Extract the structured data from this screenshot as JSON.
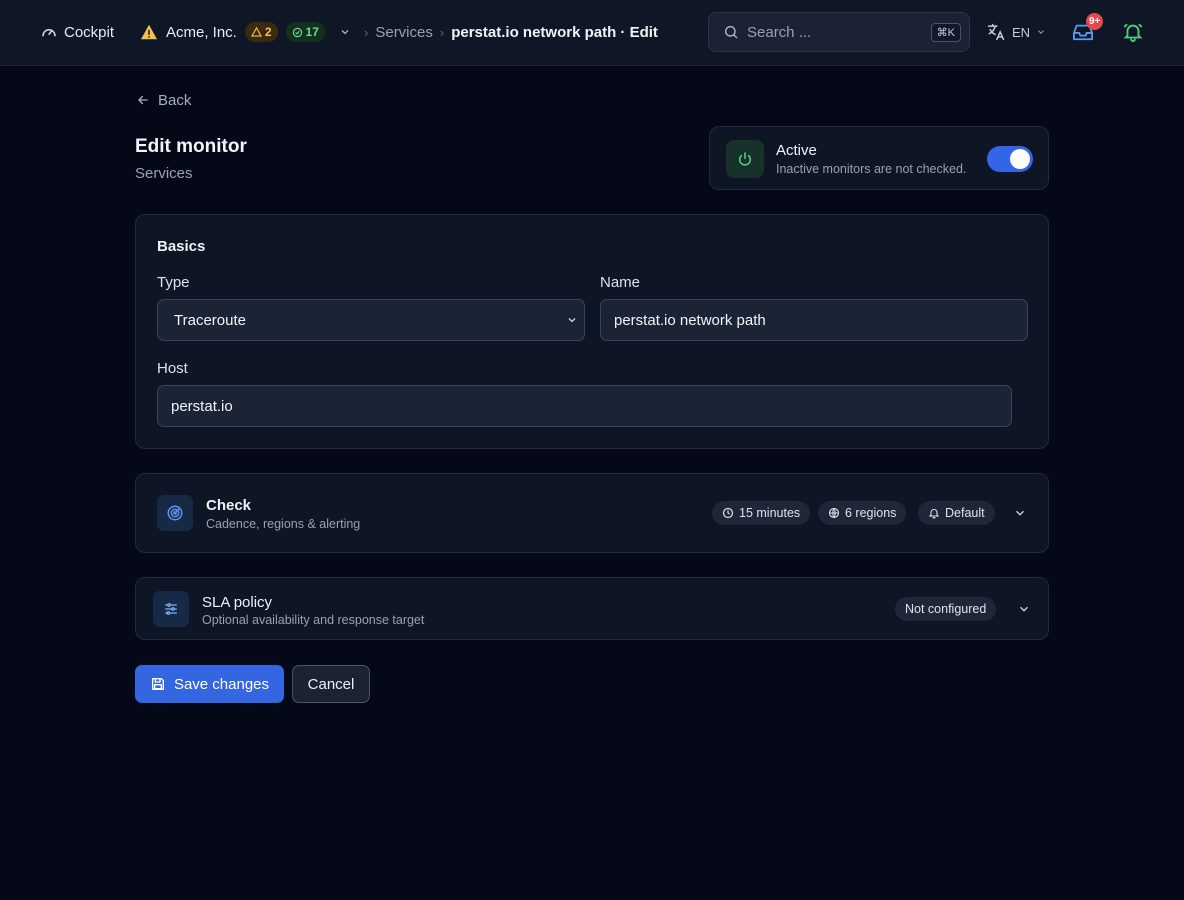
{
  "header": {
    "app_name": "Cockpit",
    "org_name": "Acme, Inc.",
    "warning_count": "2",
    "ok_count": "17",
    "breadcrumb": {
      "parent": "Services",
      "current": "perstat.io network path · Edit"
    },
    "search": {
      "placeholder": "Search ...",
      "shortcut": "⌘K"
    },
    "language": "EN",
    "inbox_badge": "9+"
  },
  "page": {
    "back_label": "Back",
    "title": "Edit monitor",
    "subtitle": "Services"
  },
  "active_card": {
    "title": "Active",
    "description": "Inactive monitors are not checked.",
    "enabled": true
  },
  "basics": {
    "section_title": "Basics",
    "type_label": "Type",
    "type_value": "Traceroute",
    "name_label": "Name",
    "name_value": "perstat.io network path",
    "host_label": "Host",
    "host_value": "perstat.io"
  },
  "check": {
    "title": "Check",
    "description": "Cadence, regions & alerting",
    "chips": {
      "interval": "15 minutes",
      "regions": "6 regions",
      "alerting": "Default"
    }
  },
  "sla": {
    "title": "SLA policy",
    "description": "Optional availability and response target",
    "status": "Not configured"
  },
  "actions": {
    "save_label": "Save changes",
    "cancel_label": "Cancel"
  },
  "colors": {
    "accent": "#3366e0",
    "background": "#050816",
    "warning": "#f3c24c",
    "success": "#74d394",
    "badge": "#e5484d"
  }
}
